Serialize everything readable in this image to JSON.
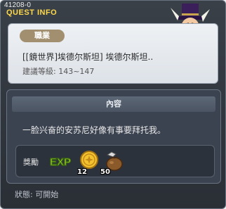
{
  "window": {
    "quest_id": "41208-0",
    "title": "QUEST INFO"
  },
  "job": {
    "badge": "職業",
    "name": "[[鏡世界]埃德尔斯坦] 埃德尔斯坦..",
    "level": "建議等級: 143~147"
  },
  "content": {
    "header": "內容",
    "text": "一脸兴奋的安苏尼好像有事要拜托我。"
  },
  "reward": {
    "label": "獎勵",
    "exp_label": "EXP",
    "items": [
      {
        "icon": "gold-coin-icon",
        "count": "12"
      },
      {
        "icon": "sack-icon",
        "count": "50"
      }
    ]
  },
  "status": "狀態:  可開始",
  "colors": {
    "title": "#ffd84a",
    "badge": "#a18f70",
    "panel_dark": "#3b4250"
  }
}
